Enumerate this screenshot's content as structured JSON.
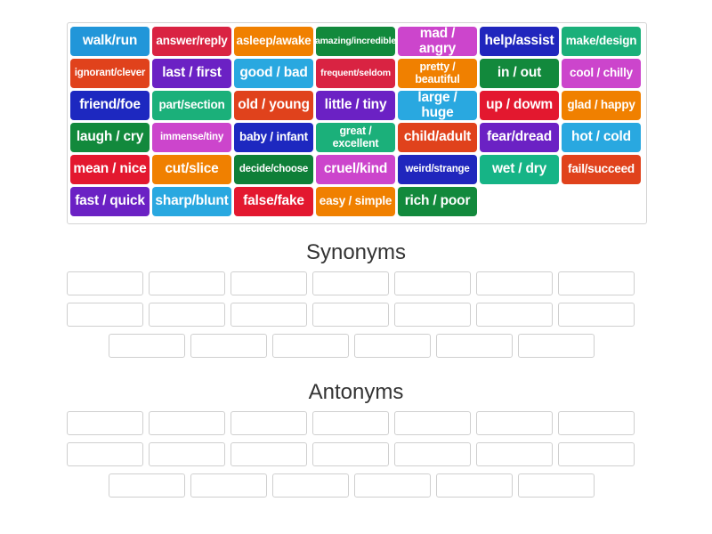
{
  "word_bank": {
    "rows": [
      [
        {
          "label": "walk/run",
          "color": "#2196d9",
          "size": "s16"
        },
        {
          "label": "answer/reply",
          "color": "#d92342",
          "size": "s14"
        },
        {
          "label": "asleep/awake",
          "color": "#f08000",
          "size": "s14"
        },
        {
          "label": "amazing/incredible",
          "color": "#12893c",
          "size": "s11"
        },
        {
          "label": "mad / angry",
          "color": "#cc45cc",
          "size": "s16"
        },
        {
          "label": "help/assist",
          "color": "#2026bd",
          "size": "s16"
        },
        {
          "label": "make/design",
          "color": "#1bb07a",
          "size": "s14"
        }
      ],
      [
        {
          "label": "ignorant/clever",
          "color": "#e0421c",
          "size": "s12"
        },
        {
          "label": "last / first",
          "color": "#6b21c4",
          "size": "s16"
        },
        {
          "label": "good / bad",
          "color": "#29a8e0",
          "size": "s16"
        },
        {
          "label": "frequent/seldom",
          "color": "#d92342",
          "size": "s11"
        },
        {
          "label": "pretty /\nbeautiful",
          "color": "#f08000",
          "size": "two"
        },
        {
          "label": "in / out",
          "color": "#12893c",
          "size": "s16"
        },
        {
          "label": "cool / chilly",
          "color": "#cc45cc",
          "size": "s14"
        }
      ],
      [
        {
          "label": "friend/foe",
          "color": "#1d28c0",
          "size": "s16"
        },
        {
          "label": "part/section",
          "color": "#1bb07a",
          "size": "s14"
        },
        {
          "label": "old / young",
          "color": "#e0421c",
          "size": "s16"
        },
        {
          "label": "little / tiny",
          "color": "#6b21c4",
          "size": "s16"
        },
        {
          "label": "large / huge",
          "color": "#29a8e0",
          "size": "s16"
        },
        {
          "label": "up / dowm",
          "color": "#e3182f",
          "size": "s16"
        },
        {
          "label": "glad / happy",
          "color": "#f08000",
          "size": "s14"
        }
      ],
      [
        {
          "label": "laugh / cry",
          "color": "#12893c",
          "size": "s16"
        },
        {
          "label": "immense/tiny",
          "color": "#cc45cc",
          "size": "s12"
        },
        {
          "label": "baby / infant",
          "color": "#1d28c0",
          "size": "s14"
        },
        {
          "label": "great /\nexcellent",
          "color": "#1bb07a",
          "size": "two"
        },
        {
          "label": "child/adult",
          "color": "#e0421c",
          "size": "s16"
        },
        {
          "label": "fear/dread",
          "color": "#6b21c4",
          "size": "s16"
        },
        {
          "label": "hot / cold",
          "color": "#29a8e0",
          "size": "s16"
        }
      ],
      [
        {
          "label": "mean / nice",
          "color": "#e3182f",
          "size": "s16"
        },
        {
          "label": "cut/slice",
          "color": "#f08000",
          "size": "s16"
        },
        {
          "label": "decide/choose",
          "color": "#0f7f38",
          "size": "s12"
        },
        {
          "label": "cruel/kind",
          "color": "#cc45cc",
          "size": "s16"
        },
        {
          "label": "weird/strange",
          "color": "#2026bd",
          "size": "s12"
        },
        {
          "label": "wet / dry",
          "color": "#16b486",
          "size": "s16"
        },
        {
          "label": "fail/succeed",
          "color": "#e0421c",
          "size": "s14"
        }
      ],
      [
        {
          "label": "fast / quick",
          "color": "#6b21c4",
          "size": "s16"
        },
        {
          "label": "sharp/blunt",
          "color": "#29a8e0",
          "size": "s16"
        },
        {
          "label": "false/fake",
          "color": "#e3182f",
          "size": "s16"
        },
        {
          "label": "easy / simple",
          "color": "#f08000",
          "size": "s14"
        },
        {
          "label": "rich / poor",
          "color": "#12893c",
          "size": "s16"
        }
      ]
    ]
  },
  "drop_zones": [
    {
      "title": "Synonyms",
      "slot_rows": [
        7,
        7,
        6
      ]
    },
    {
      "title": "Antonyms",
      "slot_rows": [
        7,
        7,
        6
      ]
    }
  ],
  "colors": {
    "page_background": "#ffffff",
    "bank_border": "#d4d4d4",
    "slot_border": "#cfcfcf",
    "heading_text": "#333333",
    "tile_text": "#ffffff"
  }
}
